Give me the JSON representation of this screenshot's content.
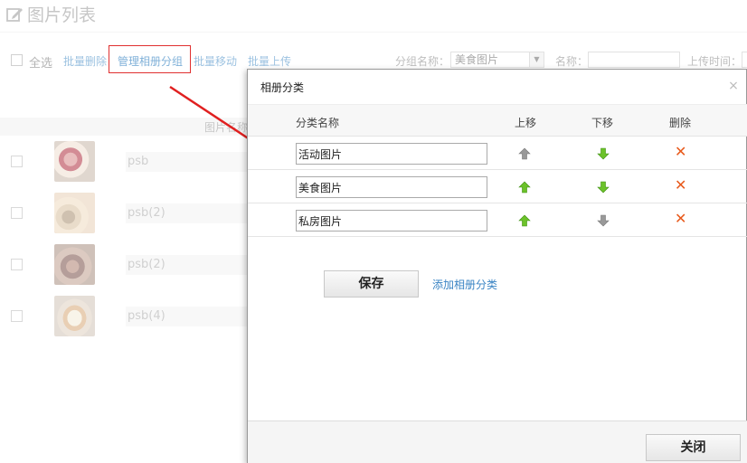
{
  "page": {
    "title": "图片列表",
    "toolbar": {
      "select_all": "全选",
      "batch_delete": "批量删除",
      "manage_groups": "管理相册分组",
      "batch_move": "批量移动",
      "batch_upload": "批量上传",
      "group_name_label": "分组名称：",
      "group_selected": "美食图片",
      "name_label": "名称：",
      "upload_time_label": "上传时间："
    },
    "table_header": "图片名称",
    "rows": [
      {
        "name": "psb"
      },
      {
        "name": "psb(2)"
      },
      {
        "name": "psb(2)"
      },
      {
        "name": "psb(4)"
      }
    ]
  },
  "dialog": {
    "title": "相册分类",
    "close_icon": "×",
    "columns": {
      "name": "分类名称",
      "move_up": "上移",
      "move_down": "下移",
      "delete": "删除"
    },
    "categories": [
      {
        "name": "活动图片",
        "up_enabled": false,
        "down_enabled": true
      },
      {
        "name": "美食图片",
        "up_enabled": true,
        "down_enabled": true
      },
      {
        "name": "私房图片",
        "up_enabled": true,
        "down_enabled": false
      }
    ],
    "delete_icon": "✕",
    "save_label": "保存",
    "add_category_label": "添加相册分类",
    "close_label": "关闭"
  },
  "colors": {
    "accent_link": "#3a84c4",
    "annotation_red": "#e03030",
    "arrow_enabled": "#6cc22a",
    "arrow_disabled": "#999999",
    "delete_orange": "#e85a1c"
  }
}
